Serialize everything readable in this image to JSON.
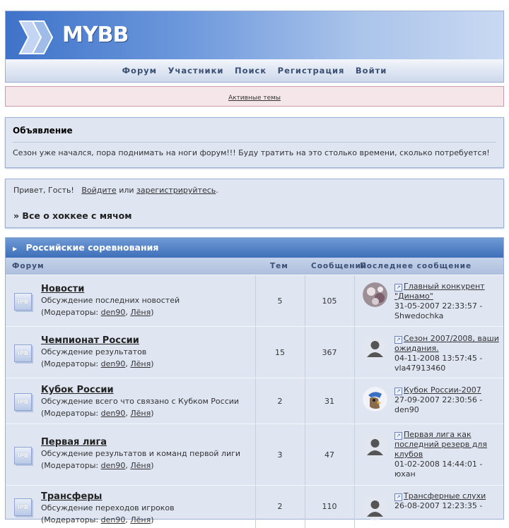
{
  "header": {
    "logo_text": "MYBB"
  },
  "nav": {
    "items": [
      "Форум",
      "Участники",
      "Поиск",
      "Регистрация",
      "Войти"
    ]
  },
  "active_topics": "Активные темы",
  "announcement": {
    "title": "Объявление",
    "body": "Сезон уже начался, пора поднимать на ноги форум!!! Буду тратить на это столько времени, сколько потребуется!"
  },
  "welcome": {
    "greeting": "Привет, Гость!",
    "login": "Войдите",
    "or": "или",
    "register": "зарегистрируйтесь",
    "dot": ".",
    "board_title": "» Все о хоккее с мячом"
  },
  "category": {
    "title": "Российские соревнования",
    "columns": {
      "forum": "Форум",
      "topics": "Тем",
      "posts": "Сообщений",
      "last": "Последнее сообщение"
    }
  },
  "moderators_label": "(Модераторы:",
  "moderators_close": ")",
  "moderators": [
    "den90",
    "Лёня"
  ],
  "forum_icon_text": "IPB",
  "last_icon": "topic-link-icon",
  "forums": [
    {
      "name": "Новости",
      "desc": "Обсуждение последних новостей",
      "topics": "5",
      "posts": "105",
      "last_title": "Главный конкурент \"Динамо\"",
      "last_date": "31-05-2007 22:33:57 -",
      "last_user": "Shwedochka",
      "avatar": "photo"
    },
    {
      "name": "Чемпионат России",
      "desc": "Обсуждение результатов",
      "topics": "15",
      "posts": "367",
      "last_title": "Сезон 2007/2008, ваши ожидания.",
      "last_date": "04-11-2008 13:57:45 -",
      "last_user": "vla47913460",
      "avatar": "default"
    },
    {
      "name": "Кубок России",
      "desc": "Обсуждение всего что связано с Кубком России",
      "topics": "2",
      "posts": "31",
      "last_title": "Кубок России-2007",
      "last_date": "27-09-2007 22:30:56 -",
      "last_user": "den90",
      "avatar": "eagle"
    },
    {
      "name": "Первая лига",
      "desc": "Обсуждение результатов и команд первой лиги",
      "topics": "3",
      "posts": "47",
      "last_title": "Первая лига как последний резерв для клубов",
      "last_date": "01-02-2008 14:44:01 -",
      "last_user": "юхан",
      "avatar": "default"
    },
    {
      "name": "Трансферы",
      "desc": "Обсуждение переходов игроков",
      "topics": "2",
      "posts": "110",
      "last_title": "Трансферные слухи",
      "last_date": "26-08-2007 12:23:35 -",
      "last_user": "",
      "avatar": "default"
    }
  ]
}
